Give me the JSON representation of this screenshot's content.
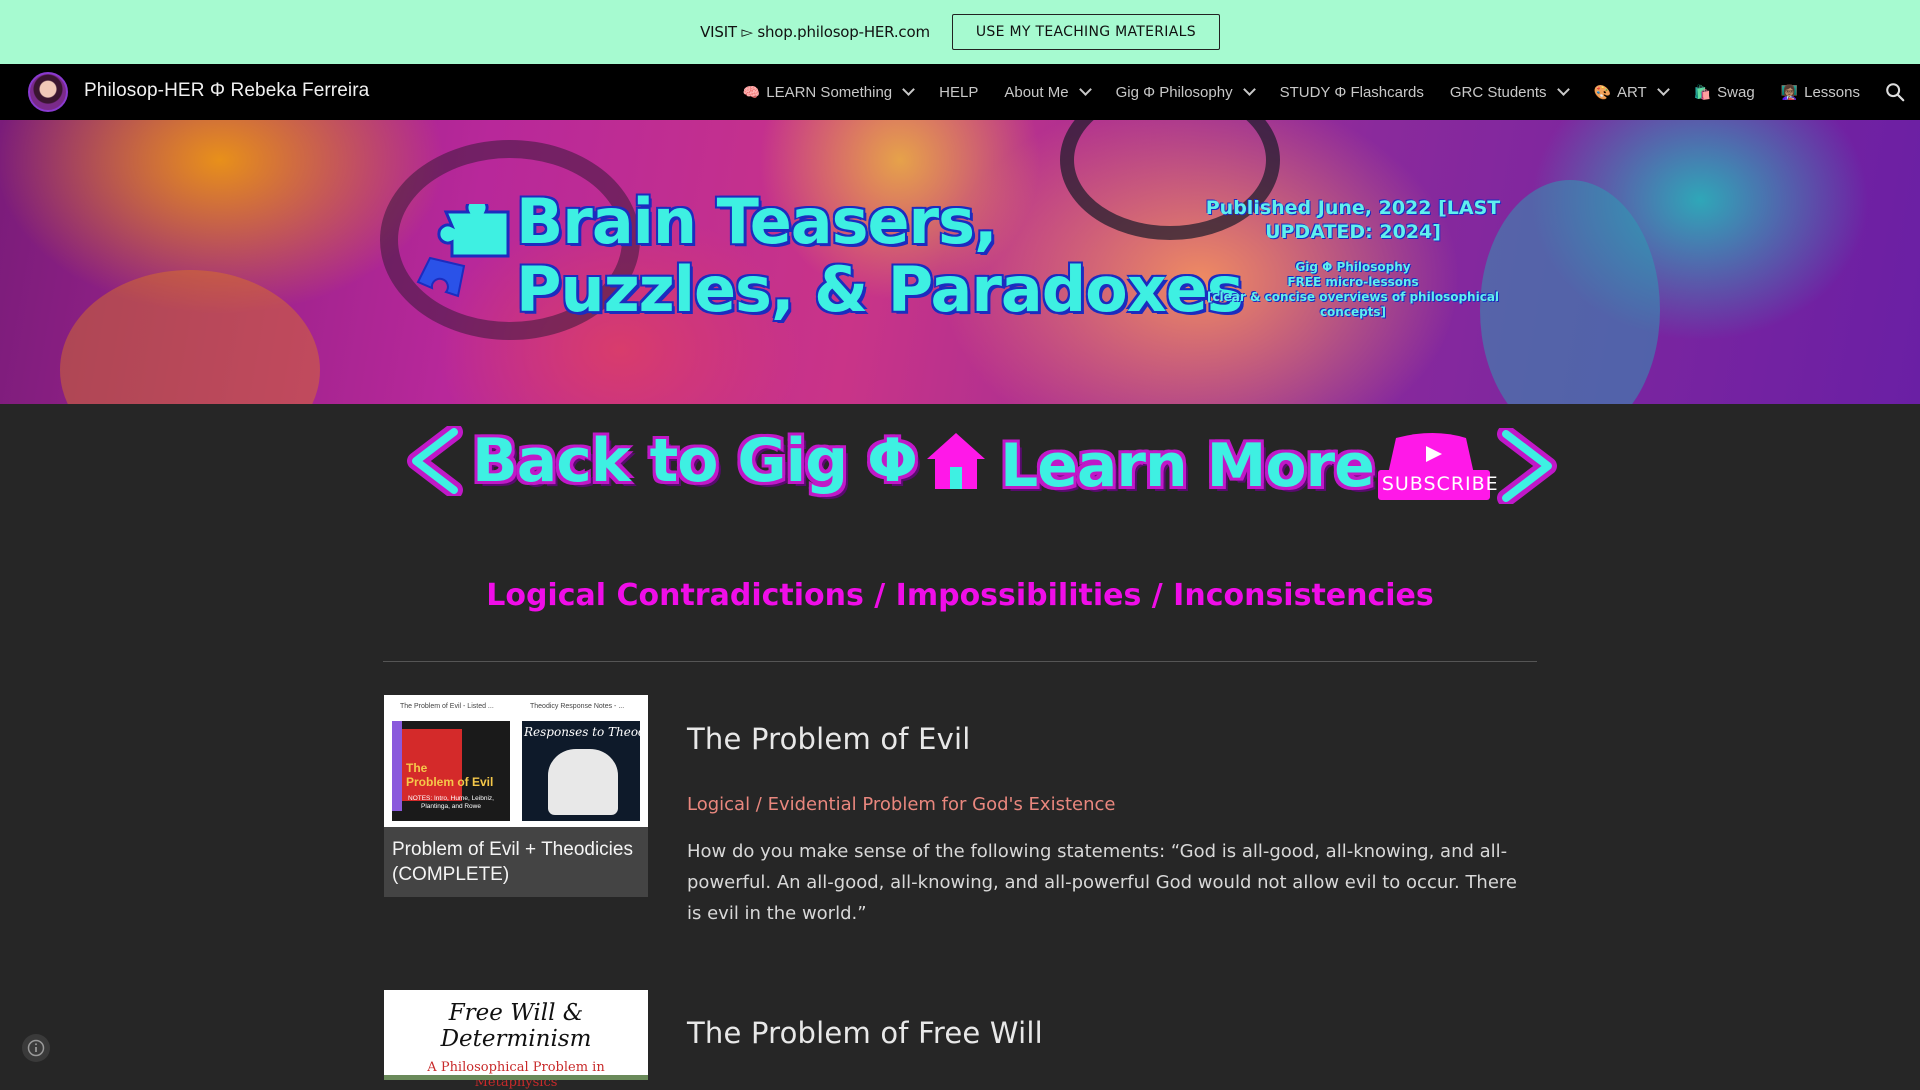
{
  "topbar": {
    "visit_text": "VISIT ▻ shop.philosop-HER.com",
    "cta_label": "USE MY TEACHING MATERIALS"
  },
  "nav": {
    "site_title": "Philosop-HER Φ Rebeka Ferreira",
    "items": [
      {
        "emoji": "🧠",
        "label": "LEARN Something",
        "dropdown": true
      },
      {
        "emoji": "",
        "label": "HELP",
        "dropdown": false
      },
      {
        "emoji": "",
        "label": "About Me",
        "dropdown": true
      },
      {
        "emoji": "",
        "label": "Gig Φ Philosophy",
        "dropdown": true
      },
      {
        "emoji": "",
        "label": "STUDY Φ Flashcards",
        "dropdown": false
      },
      {
        "emoji": "",
        "label": "GRC Students",
        "dropdown": true
      },
      {
        "emoji": "🎨",
        "label": "ART",
        "dropdown": true
      },
      {
        "emoji": "🛍️",
        "label": "Swag",
        "dropdown": false
      },
      {
        "emoji": "👩🏽‍🏫",
        "label": "Lessons",
        "dropdown": false
      }
    ]
  },
  "hero": {
    "title_line1": "Brain Teasers,",
    "title_line2": "Puzzles, & Paradoxes",
    "published": "Published June, 2022 [LAST UPDATED: 2024]",
    "series_line1": "Gig Φ Philosophy",
    "series_line2": "FREE micro-lessons",
    "series_line3": "[clear & concise overviews of philosophical concepts]"
  },
  "buttons": {
    "back_label": "Back to Gig Φ",
    "learn_label": "Learn More",
    "subscribe_label": "SUBSCRIBE"
  },
  "section_heading": "Logical Contradictions / Impossibilities / Inconsistencies",
  "entries": [
    {
      "card_caption": "Problem of Evil + Theodicies (COMPLETE)",
      "thumb_left_header": "The Problem of Evil - Listed ...",
      "thumb_left_title1": "The",
      "thumb_left_title2": "Problem of Evil",
      "thumb_left_notes": "NOTES: Intro, Hume, Leibniz, Plantinga, and Rowe",
      "thumb_right_header": "Theodicy Response Notes - ...",
      "thumb_right_title": "Responses to Theodicies",
      "title": "The Problem of Evil",
      "subtitle": "Logical / Evidential Problem for God's Existence",
      "description": "How do you make sense of the following statements: “God is all-good, all-knowing, and all-powerful. An all-good, all-knowing, and all-powerful God would not allow evil to occur. There is evil in the world.”"
    },
    {
      "thumb_title": "Free Will & Determinism",
      "thumb_subtitle": "A Philosophical Problem in Metaphysics",
      "title": "The Problem of Free Will"
    }
  ],
  "colors": {
    "topbar_bg": "#a6fad0",
    "nav_bg": "#000000",
    "page_bg": "#262626",
    "heading_magenta": "#f00de8",
    "subtitle_salmon": "#e9877e",
    "cyan_text": "#3ef0e2"
  },
  "icons": [
    "logo-avatar",
    "chevron-down-icon",
    "search-icon",
    "puzzle-icon",
    "left-arrow-icon",
    "home-icon",
    "play-icon",
    "right-arrow-icon",
    "info-icon"
  ]
}
